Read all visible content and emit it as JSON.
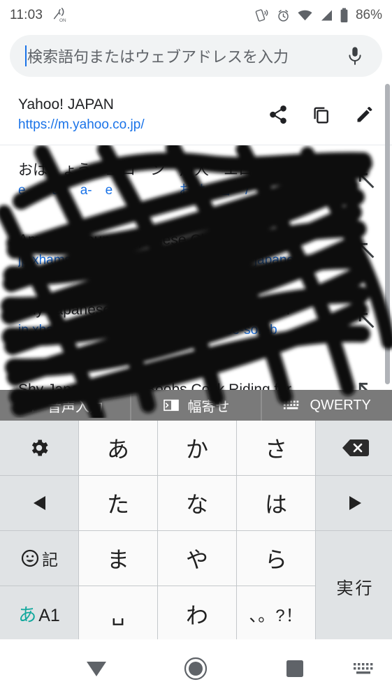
{
  "status_bar": {
    "time": "11:03",
    "battery_percent": "86%",
    "icons": {
      "vibrate": "vibrate-on-icon",
      "nfc": "nfc-icon",
      "alarm": "alarm-clock-icon",
      "wifi": "wifi-icon",
      "cellular": "cellular-signal-icon",
      "battery": "battery-icon"
    }
  },
  "omnibox": {
    "placeholder": "検索語句またはウェブアドレスを入力",
    "value": "",
    "mic_icon": "microphone-icon",
    "caret_color": "#1a73e8"
  },
  "suggestions": {
    "items": [
      {
        "title": "Yahoo! JAPAN",
        "url": "https://m.yahoo.co.jp/",
        "redacted": false,
        "actions": [
          "share-icon",
          "copy-icon",
          "edit-icon"
        ]
      },
      {
        "title": "おは　ょう　工ロ　ン　戸人　エロ",
        "url": "e…　an　a-　e　　　　　おは　ョ　/",
        "redacted": true,
        "actions": [
          "insert-arrow-icon"
        ]
      },
      {
        "title": "Amateur Young Japanese Chubby Creampi",
        "url": "jp.xhamster.com/videos/amateur-young-japane",
        "redacted": true,
        "actions": [
          "insert-arrow-icon"
        ]
      },
      {
        "title": "Shy Japanese Soft Boobs Cock Riding for",
        "url": "jp.xhamster.com/videos/shy-japanese-soft-b",
        "redacted": true,
        "actions": [
          "insert-arrow-icon"
        ]
      },
      {
        "title": "Shy Japanese Soft Boobs Cock Riding for",
        "url": "",
        "redacted": true,
        "actions": [
          "insert-arrow-icon"
        ]
      }
    ]
  },
  "keyboard": {
    "toolbar": [
      {
        "label": "音声入力",
        "icon": "microphone-icon"
      },
      {
        "label": "幅寄せ",
        "icon": "align-width-icon"
      },
      {
        "label": "QWERTY",
        "icon": "keyboard-icon"
      }
    ],
    "rows": [
      [
        {
          "label": "",
          "name": "settings-key",
          "icon": "gear-icon",
          "type": "fn"
        },
        {
          "label": "あ",
          "name": "key-a",
          "type": "kana"
        },
        {
          "label": "か",
          "name": "key-ka",
          "type": "kana"
        },
        {
          "label": "さ",
          "name": "key-sa",
          "type": "kana"
        },
        {
          "label": "",
          "name": "backspace-key",
          "icon": "backspace-icon",
          "type": "fn"
        }
      ],
      [
        {
          "label": "",
          "name": "cursor-left-key",
          "icon": "triangle-left-icon",
          "type": "fn"
        },
        {
          "label": "た",
          "name": "key-ta",
          "type": "kana"
        },
        {
          "label": "な",
          "name": "key-na",
          "type": "kana"
        },
        {
          "label": "は",
          "name": "key-ha",
          "type": "kana"
        },
        {
          "label": "",
          "name": "cursor-right-key",
          "icon": "triangle-right-icon",
          "type": "fn"
        }
      ],
      [
        {
          "label": "記",
          "name": "emoji-symbol-key",
          "icon": "emoji-icon",
          "type": "fn"
        },
        {
          "label": "ま",
          "name": "key-ma",
          "type": "kana"
        },
        {
          "label": "や",
          "name": "key-ya",
          "type": "kana"
        },
        {
          "label": "ら",
          "name": "key-ra",
          "type": "kana"
        },
        {
          "label": "実行",
          "name": "enter-key",
          "type": "enter"
        }
      ],
      [
        {
          "label_ja": "あ",
          "label_en": "A1",
          "name": "input-mode-key",
          "type": "mode"
        },
        {
          "label": "␣",
          "name": "space-key",
          "type": "space"
        },
        {
          "label": "わ",
          "name": "key-wa",
          "type": "kana"
        },
        {
          "label": "、。?！",
          "name": "punctuation-key",
          "type": "punct"
        }
      ]
    ],
    "mode_key_accent": "#12a89d"
  },
  "navbar": {
    "back": "triangle-down-icon",
    "home": "home-circle-icon",
    "recents": "square-icon",
    "keyboard_switch": "keyboard-switch-icon"
  }
}
